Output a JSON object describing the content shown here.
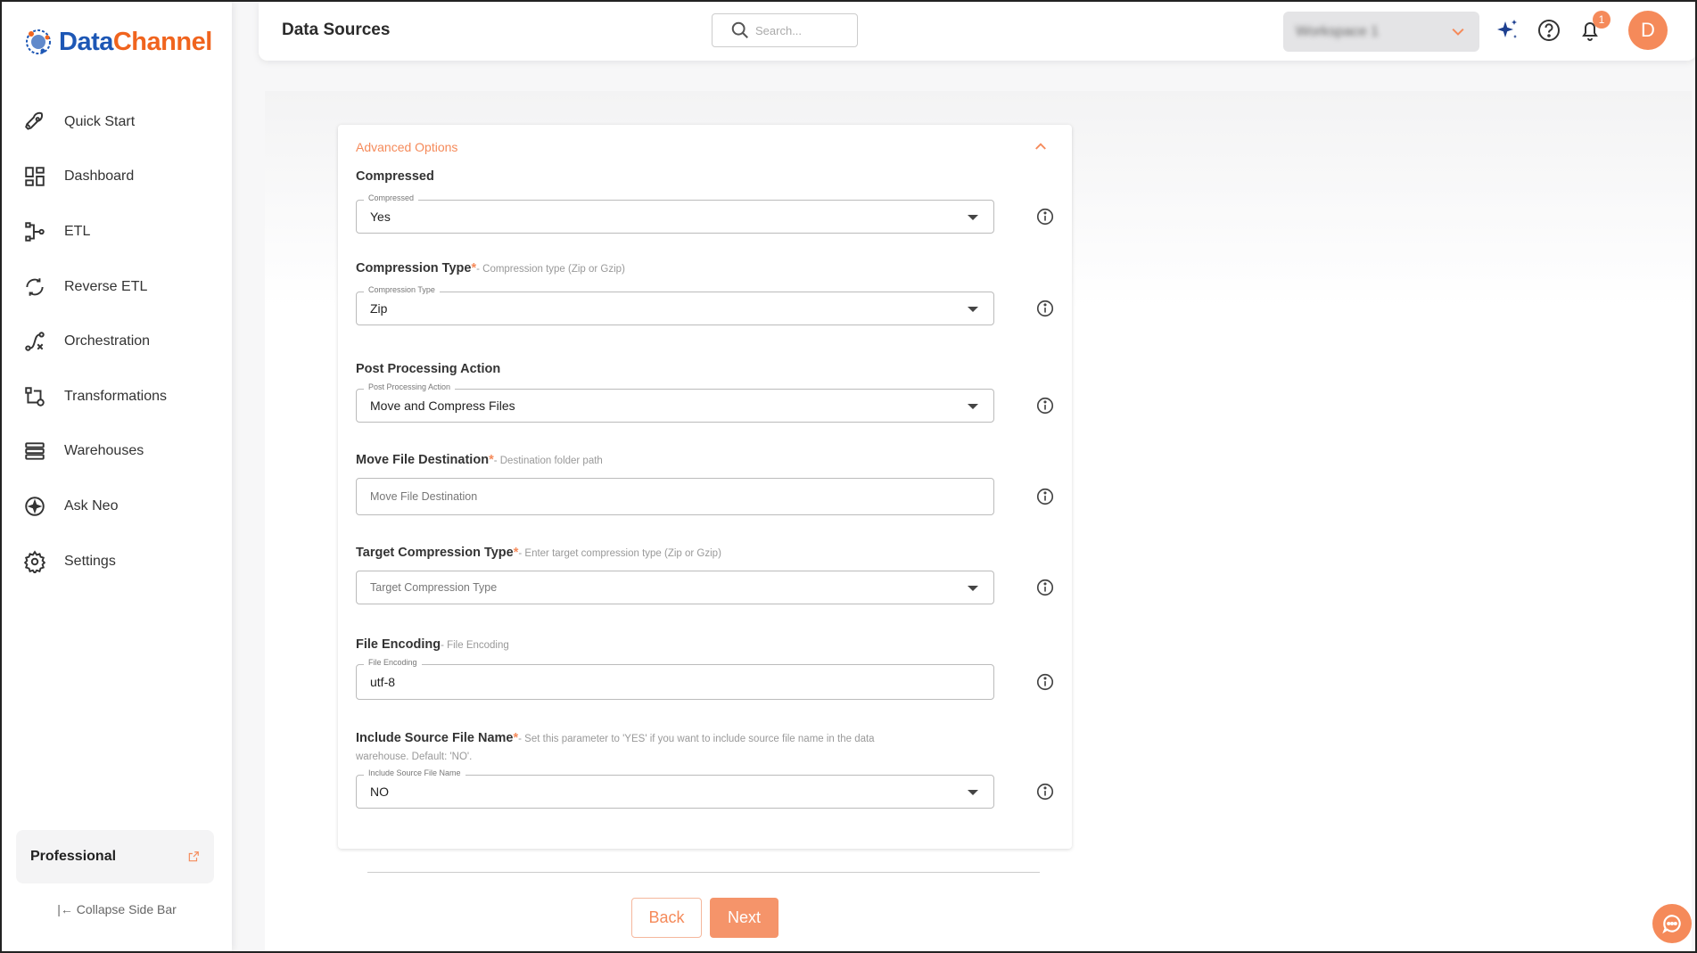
{
  "brand": {
    "name_part1": "Data",
    "name_part2": "Channel",
    "primary_color": "#1d57b5",
    "accent_color": "#f0641e"
  },
  "sidebar": {
    "items": [
      {
        "label": "Quick Start",
        "icon": "rocket-icon"
      },
      {
        "label": "Dashboard",
        "icon": "dashboard-icon"
      },
      {
        "label": "ETL",
        "icon": "etl-icon"
      },
      {
        "label": "Reverse ETL",
        "icon": "reverse-etl-icon"
      },
      {
        "label": "Orchestration",
        "icon": "orchestration-icon"
      },
      {
        "label": "Transformations",
        "icon": "transformations-icon"
      },
      {
        "label": "Warehouses",
        "icon": "warehouses-icon"
      },
      {
        "label": "Ask Neo",
        "icon": "sparkle-icon"
      },
      {
        "label": "Settings",
        "icon": "gear-icon"
      }
    ],
    "plan": "Professional",
    "collapse_label": "Collapse Side Bar"
  },
  "header": {
    "title": "Data Sources",
    "search_placeholder": "Search...",
    "workspace_name": "Workspace 1",
    "notification_count": "1",
    "avatar_initial": "D"
  },
  "form": {
    "section_title": "Advanced Options",
    "fields": [
      {
        "label": "Compressed",
        "required": "",
        "hint": "",
        "float_label": "Compressed",
        "value": "Yes",
        "placeholder": "",
        "type": "select"
      },
      {
        "label": "Compression Type",
        "required": "*",
        "hint": "- Compression type (Zip or Gzip)",
        "float_label": "Compression Type",
        "value": "Zip",
        "placeholder": "",
        "type": "select"
      },
      {
        "label": "Post Processing Action",
        "required": "",
        "hint": "",
        "float_label": "Post Processing Action",
        "value": "Move and Compress Files",
        "placeholder": "",
        "type": "select"
      },
      {
        "label": "Move File Destination",
        "required": "*",
        "hint": "- Destination folder path",
        "float_label": "",
        "value": "",
        "placeholder": "Move File Destination",
        "type": "input"
      },
      {
        "label": "Target Compression Type",
        "required": "*",
        "hint": "- Enter target compression type (Zip or Gzip)",
        "float_label": "",
        "value": "",
        "placeholder": "Target Compression Type",
        "type": "select"
      },
      {
        "label": "File Encoding",
        "required": "",
        "hint": "- File Encoding",
        "float_label": "File Encoding",
        "value": "utf-8",
        "placeholder": "",
        "type": "input"
      },
      {
        "label": "Include Source File Name",
        "required": "*",
        "hint": "- Set this parameter to 'YES' if you want to include source file name in the data warehouse. Default: 'NO'.",
        "float_label": "Include Source File Name",
        "value": "NO",
        "placeholder": "",
        "type": "select"
      }
    ]
  },
  "actions": {
    "back_label": "Back",
    "next_label": "Next"
  }
}
